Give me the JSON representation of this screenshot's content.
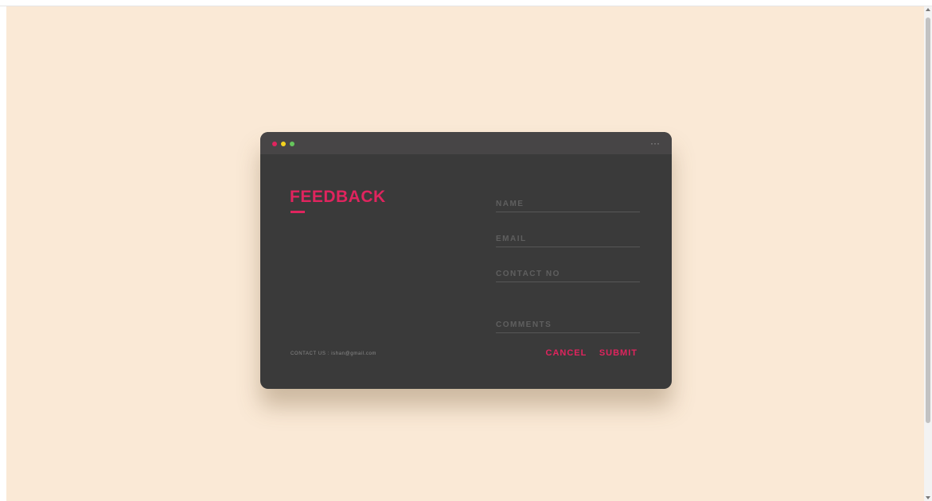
{
  "window": {
    "more_icon": "···",
    "title": "FEEDBACK",
    "contact_us": "CONTACT US : ishan@gmail.com"
  },
  "form": {
    "name_placeholder": "NAME",
    "email_placeholder": "EMAIL",
    "contact_placeholder": "CONTACT NO",
    "comments_placeholder": "COMMENTS",
    "name_value": "",
    "email_value": "",
    "contact_value": "",
    "comments_value": ""
  },
  "actions": {
    "cancel_label": "CANCEL",
    "submit_label": "SUBMIT"
  },
  "colors": {
    "accent": "#e0245e",
    "background": "#fae9d6",
    "card": "#3a3a3a",
    "titlebar": "#474546",
    "dot_red": "#e0245e",
    "dot_yellow": "#f2d21f",
    "dot_green": "#66c55c"
  }
}
